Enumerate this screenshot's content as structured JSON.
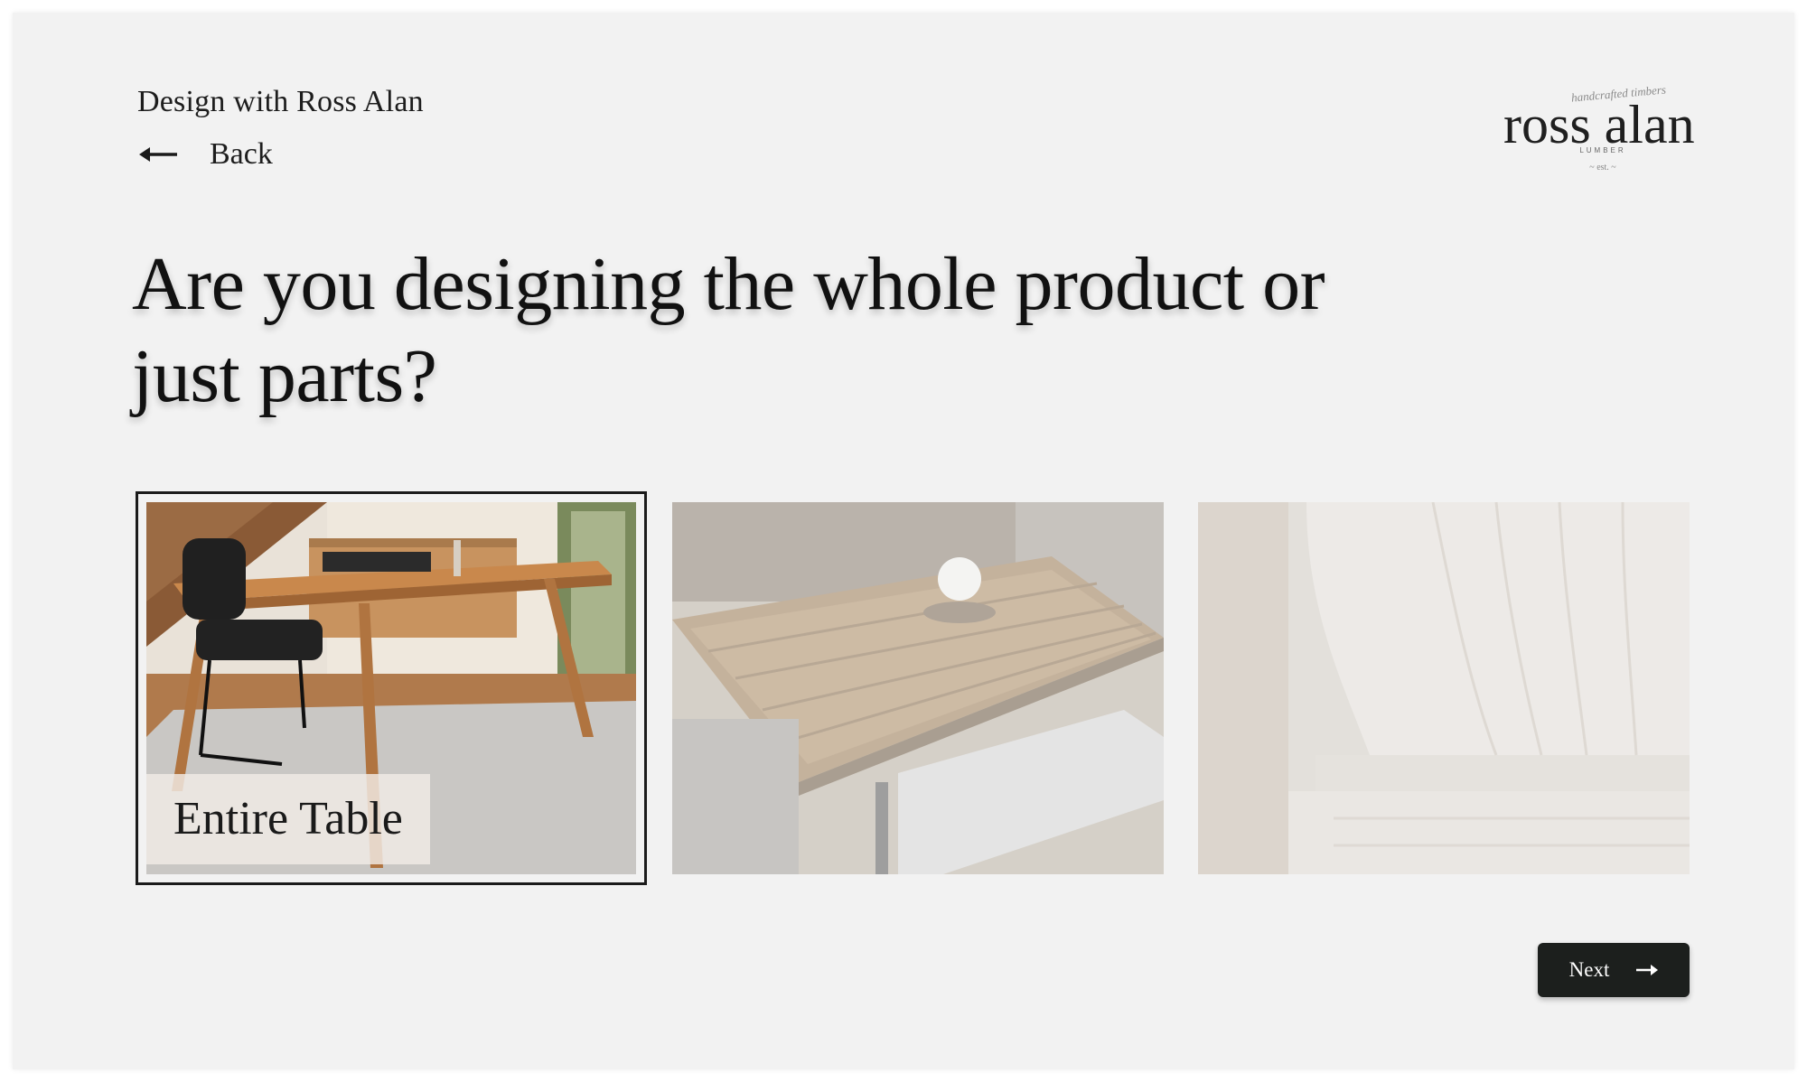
{
  "header": {
    "brand_line": "Design with Ross Alan",
    "back_label": "Back"
  },
  "logo": {
    "script": "handcrafted timbers",
    "wordmark": "ross alan",
    "sub": "LUMBER",
    "mark": "~ est. ~"
  },
  "question": {
    "title": "Are you designing the whole product or just parts?"
  },
  "options": [
    {
      "label": "Entire Table",
      "selected": true,
      "image": "desk-with-chair-photo"
    },
    {
      "label": "",
      "selected": false,
      "image": "reclaimed-wood-tabletop-photo"
    },
    {
      "label": "",
      "selected": false,
      "image": "turned-wood-leg-closeup-photo"
    }
  ],
  "footer": {
    "next_label": "Next"
  },
  "colors": {
    "background": "#f2f2f2",
    "button": "#1c1f1d",
    "selected_border": "#1b1b1b"
  }
}
